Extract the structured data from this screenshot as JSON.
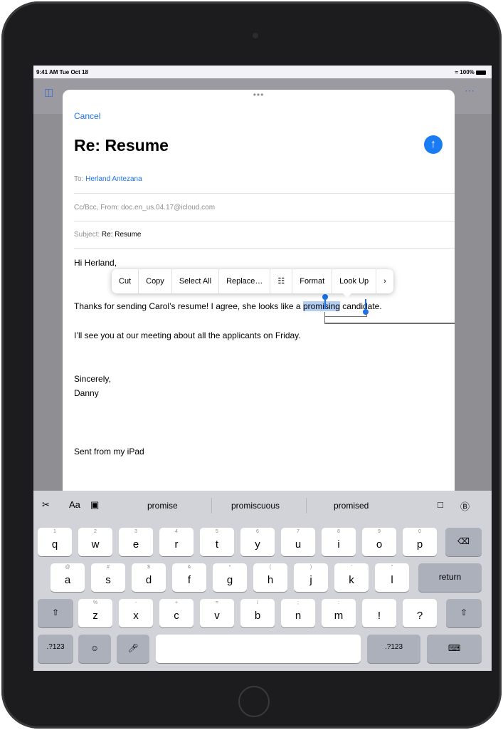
{
  "status": {
    "time": "9:41 AM  Tue Oct 18",
    "battery": "100%"
  },
  "email": {
    "cancel": "Cancel",
    "title": "Re: Resume",
    "to_label": "To:",
    "to_value": "Herland Antezana",
    "ccbcc_from": "Cc/Bcc, From:",
    "from_value": "doc.en_us.04.17@icloud.com",
    "subject_label": "Subject:",
    "subject_value": "Re: Resume",
    "greeting": "Hi Herland,",
    "line1_before": "Thanks for sending Carol’s resume! I agree, she looks like a ",
    "line1_selected": "promising",
    "line1_after": " candidate.",
    "line2": "I’ll see you at our meeting about all the applicants on Friday.",
    "closing": "Sincerely,",
    "name": "Danny",
    "signature": "Sent from my iPad"
  },
  "context_menu": {
    "items": [
      "Cut",
      "Copy",
      "Select All",
      "Replace…",
      "☷",
      "Format",
      "Look Up",
      "›"
    ]
  },
  "keyboard": {
    "toolbar_left": {
      "format_icon": "Aa"
    },
    "predictions": [
      "promise",
      "promiscuous",
      "promised"
    ],
    "row1": [
      {
        "ch": "q",
        "hint": "1"
      },
      {
        "ch": "w",
        "hint": "2"
      },
      {
        "ch": "e",
        "hint": "3"
      },
      {
        "ch": "r",
        "hint": "4"
      },
      {
        "ch": "t",
        "hint": "5"
      },
      {
        "ch": "y",
        "hint": "6"
      },
      {
        "ch": "u",
        "hint": "7"
      },
      {
        "ch": "i",
        "hint": "8"
      },
      {
        "ch": "o",
        "hint": "9"
      },
      {
        "ch": "p",
        "hint": "0"
      }
    ],
    "row2": [
      {
        "ch": "a",
        "hint": "@"
      },
      {
        "ch": "s",
        "hint": "#"
      },
      {
        "ch": "d",
        "hint": "$"
      },
      {
        "ch": "f",
        "hint": "&"
      },
      {
        "ch": "g",
        "hint": "*"
      },
      {
        "ch": "h",
        "hint": "("
      },
      {
        "ch": "j",
        "hint": ")"
      },
      {
        "ch": "k",
        "hint": "'"
      },
      {
        "ch": "l",
        "hint": "\""
      }
    ],
    "row3": [
      {
        "ch": "z",
        "hint": "%"
      },
      {
        "ch": "x",
        "hint": "-"
      },
      {
        "ch": "c",
        "hint": "+"
      },
      {
        "ch": "v",
        "hint": "="
      },
      {
        "ch": "b",
        "hint": "/"
      },
      {
        "ch": "n",
        "hint": ";"
      },
      {
        "ch": "m",
        "hint": ":"
      },
      {
        "ch": "!",
        "hint": ""
      },
      {
        "ch": "?",
        "hint": ""
      }
    ],
    "return_label": "return",
    "num_label": ".?123"
  },
  "icons": [
    "scissors-icon",
    "camera-icon",
    "document-icon",
    "pen-icon",
    "delete-icon",
    "shift-icon",
    "emoji-icon",
    "microphone-icon",
    "keyboard-hide-icon",
    "send-icon"
  ]
}
